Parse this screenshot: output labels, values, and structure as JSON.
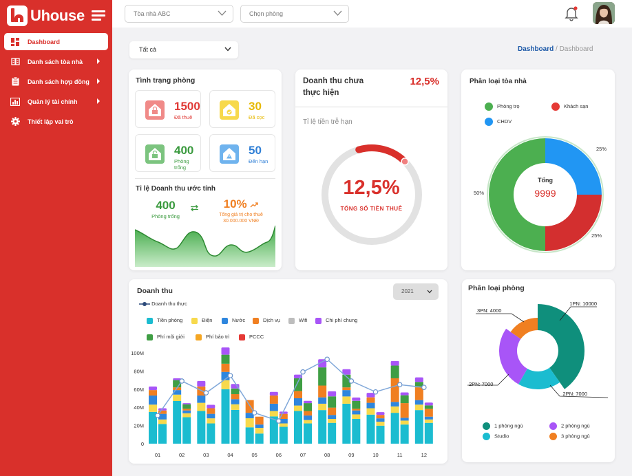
{
  "app": {
    "name": "Uhouse"
  },
  "sidebar": {
    "items": [
      {
        "label": "Dashboard",
        "active": true,
        "icon": "dashboard-icon"
      },
      {
        "label": "Danh sách tòa nhà",
        "icon": "building-list-icon"
      },
      {
        "label": "Danh sách hợp đồng",
        "icon": "contract-icon"
      },
      {
        "label": "Quản lý tài chính",
        "icon": "finance-icon"
      },
      {
        "label": "Thiết lập vai trò",
        "icon": "gear-icon"
      }
    ]
  },
  "topbar": {
    "building_select": "Tòa nhà ABC",
    "room_select": "Chọn phòng"
  },
  "filter": {
    "value": "Tất cả"
  },
  "breadcrumb": {
    "current": "Dashboard",
    "path": "/ Dashboard"
  },
  "room_status": {
    "title": "Tình trạng phòng",
    "items": [
      {
        "value": "1500",
        "label": "Đã thuê",
        "color": "#e03a36"
      },
      {
        "value": "30",
        "label": "Đã cọc",
        "color": "#f5c518"
      },
      {
        "value": "400",
        "label": "Phòng trống",
        "color": "#3a9a3e"
      },
      {
        "value": "50",
        "label": "Đến hạn",
        "color": "#2f7fd6"
      }
    ],
    "ratio_title": "Tỉ lệ Doanh thu ước tính",
    "ratio_left_value": "400",
    "ratio_left_label": "Phòng trống",
    "ratio_right_value": "10%",
    "ratio_right_label1": "Tổng giá trị cho thuê",
    "ratio_right_label2": "30.000.000 VNĐ"
  },
  "unrealized": {
    "title1": "Doanh thu chưa",
    "title2": "thực hiện",
    "percent": "12,5%",
    "subtitle": "Tỉ lệ tiền trễ hạn",
    "gauge_value": "12,5%",
    "gauge_label": "TỔNG SỐ TIỀN THUÊ",
    "gauge_fraction": 0.125
  },
  "building_types": {
    "title": "Phân loại tòa nhà",
    "legend": [
      {
        "name": "Phòng trọ",
        "color": "#4caf50"
      },
      {
        "name": "Khách sạn",
        "color": "#e53935"
      },
      {
        "name": "CHDV",
        "color": "#2196f3"
      }
    ],
    "center_label": "Tổng",
    "center_value": "9999",
    "slices": [
      {
        "name": "CHDV",
        "value": 25,
        "label": "25%",
        "color": "#2196f3"
      },
      {
        "name": "Khách sạn",
        "value": 25,
        "label": "25%",
        "color": "#d32f2f"
      },
      {
        "name": "Phòng trọ",
        "value": 50,
        "label": "50%",
        "color": "#4caf50"
      }
    ]
  },
  "revenue": {
    "title": "Doanh thu",
    "year": "2021",
    "line_legend": "Doanh thu thực",
    "legend": [
      {
        "name": "Tiền phòng",
        "color": "#1bbcd0"
      },
      {
        "name": "Điện",
        "color": "#f7d94c"
      },
      {
        "name": "Nước",
        "color": "#2e86de"
      },
      {
        "name": "Dịch vụ",
        "color": "#f07f21"
      },
      {
        "name": "Wifi",
        "color": "#bdbdbd"
      },
      {
        "name": "Chi phí chung",
        "color": "#a855f7"
      },
      {
        "name": "Phí môi giới",
        "color": "#3f9e44"
      },
      {
        "name": "Phí bảo trì",
        "color": "#f5a623"
      },
      {
        "name": "PCCC",
        "color": "#e53935"
      }
    ]
  },
  "chart_data": [
    {
      "type": "bar",
      "title": "Doanh thu",
      "stacked": true,
      "categories": [
        "01",
        "02",
        "03",
        "04",
        "05",
        "06",
        "07",
        "08",
        "09",
        "10",
        "11",
        "12"
      ],
      "yticks": [
        "0",
        "20M",
        "40M",
        "60M",
        "80M",
        "100M"
      ],
      "ylim": [
        0,
        100
      ],
      "series": [
        {
          "name": "Tiền phòng",
          "values": [
            35,
            47,
            36,
            60,
            18,
            30,
            36,
            37,
            44,
            32,
            34,
            37
          ]
        },
        {
          "name": "Điện",
          "values": [
            8,
            7,
            9,
            10,
            10,
            6,
            6,
            7,
            8,
            7,
            7,
            6
          ]
        },
        {
          "name": "Nước",
          "values": [
            10,
            5,
            8,
            9,
            6,
            8,
            8,
            7,
            7,
            6,
            5,
            5
          ]
        },
        {
          "name": "Dịch vụ",
          "values": [
            6,
            3,
            10,
            9,
            14,
            9,
            8,
            13,
            3,
            6,
            26,
            14
          ]
        },
        {
          "name": "Phí môi giới",
          "values": [
            0,
            8,
            0,
            10,
            0,
            0,
            14,
            20,
            14,
            0,
            14,
            6
          ]
        },
        {
          "name": "Chi phí chung",
          "values": [
            4,
            2,
            6,
            8,
            0,
            4,
            4,
            9,
            6,
            5,
            5,
            5
          ]
        }
      ],
      "line": {
        "name": "Doanh thu thực",
        "values": [
          31,
          69,
          56,
          75,
          34,
          25,
          79,
          93,
          69,
          57,
          65,
          62
        ]
      }
    },
    {
      "type": "pie",
      "title": "Phân loại phòng",
      "slices": [
        {
          "name": "1PN",
          "value": 10000,
          "label": "1PN: 10000",
          "color": "#0f8f7c"
        },
        {
          "name": "2PN",
          "value": 7000,
          "label": "2PN: 7000",
          "color": "#1bbcd0"
        },
        {
          "name": "2PN",
          "value": 7000,
          "label": "2PN: 7000",
          "color": "#a855f7"
        },
        {
          "name": "3PN",
          "value": 4000,
          "label": "3PN: 4000",
          "color": "#f07f21"
        }
      ],
      "legend": [
        {
          "name": "1 phòng ngủ",
          "color": "#0f8f7c"
        },
        {
          "name": "2 phòng ngủ",
          "color": "#a855f7"
        },
        {
          "name": "Studio",
          "color": "#1bbcd0"
        },
        {
          "name": "3 phòng ngủ",
          "color": "#f07f21"
        }
      ]
    }
  ]
}
